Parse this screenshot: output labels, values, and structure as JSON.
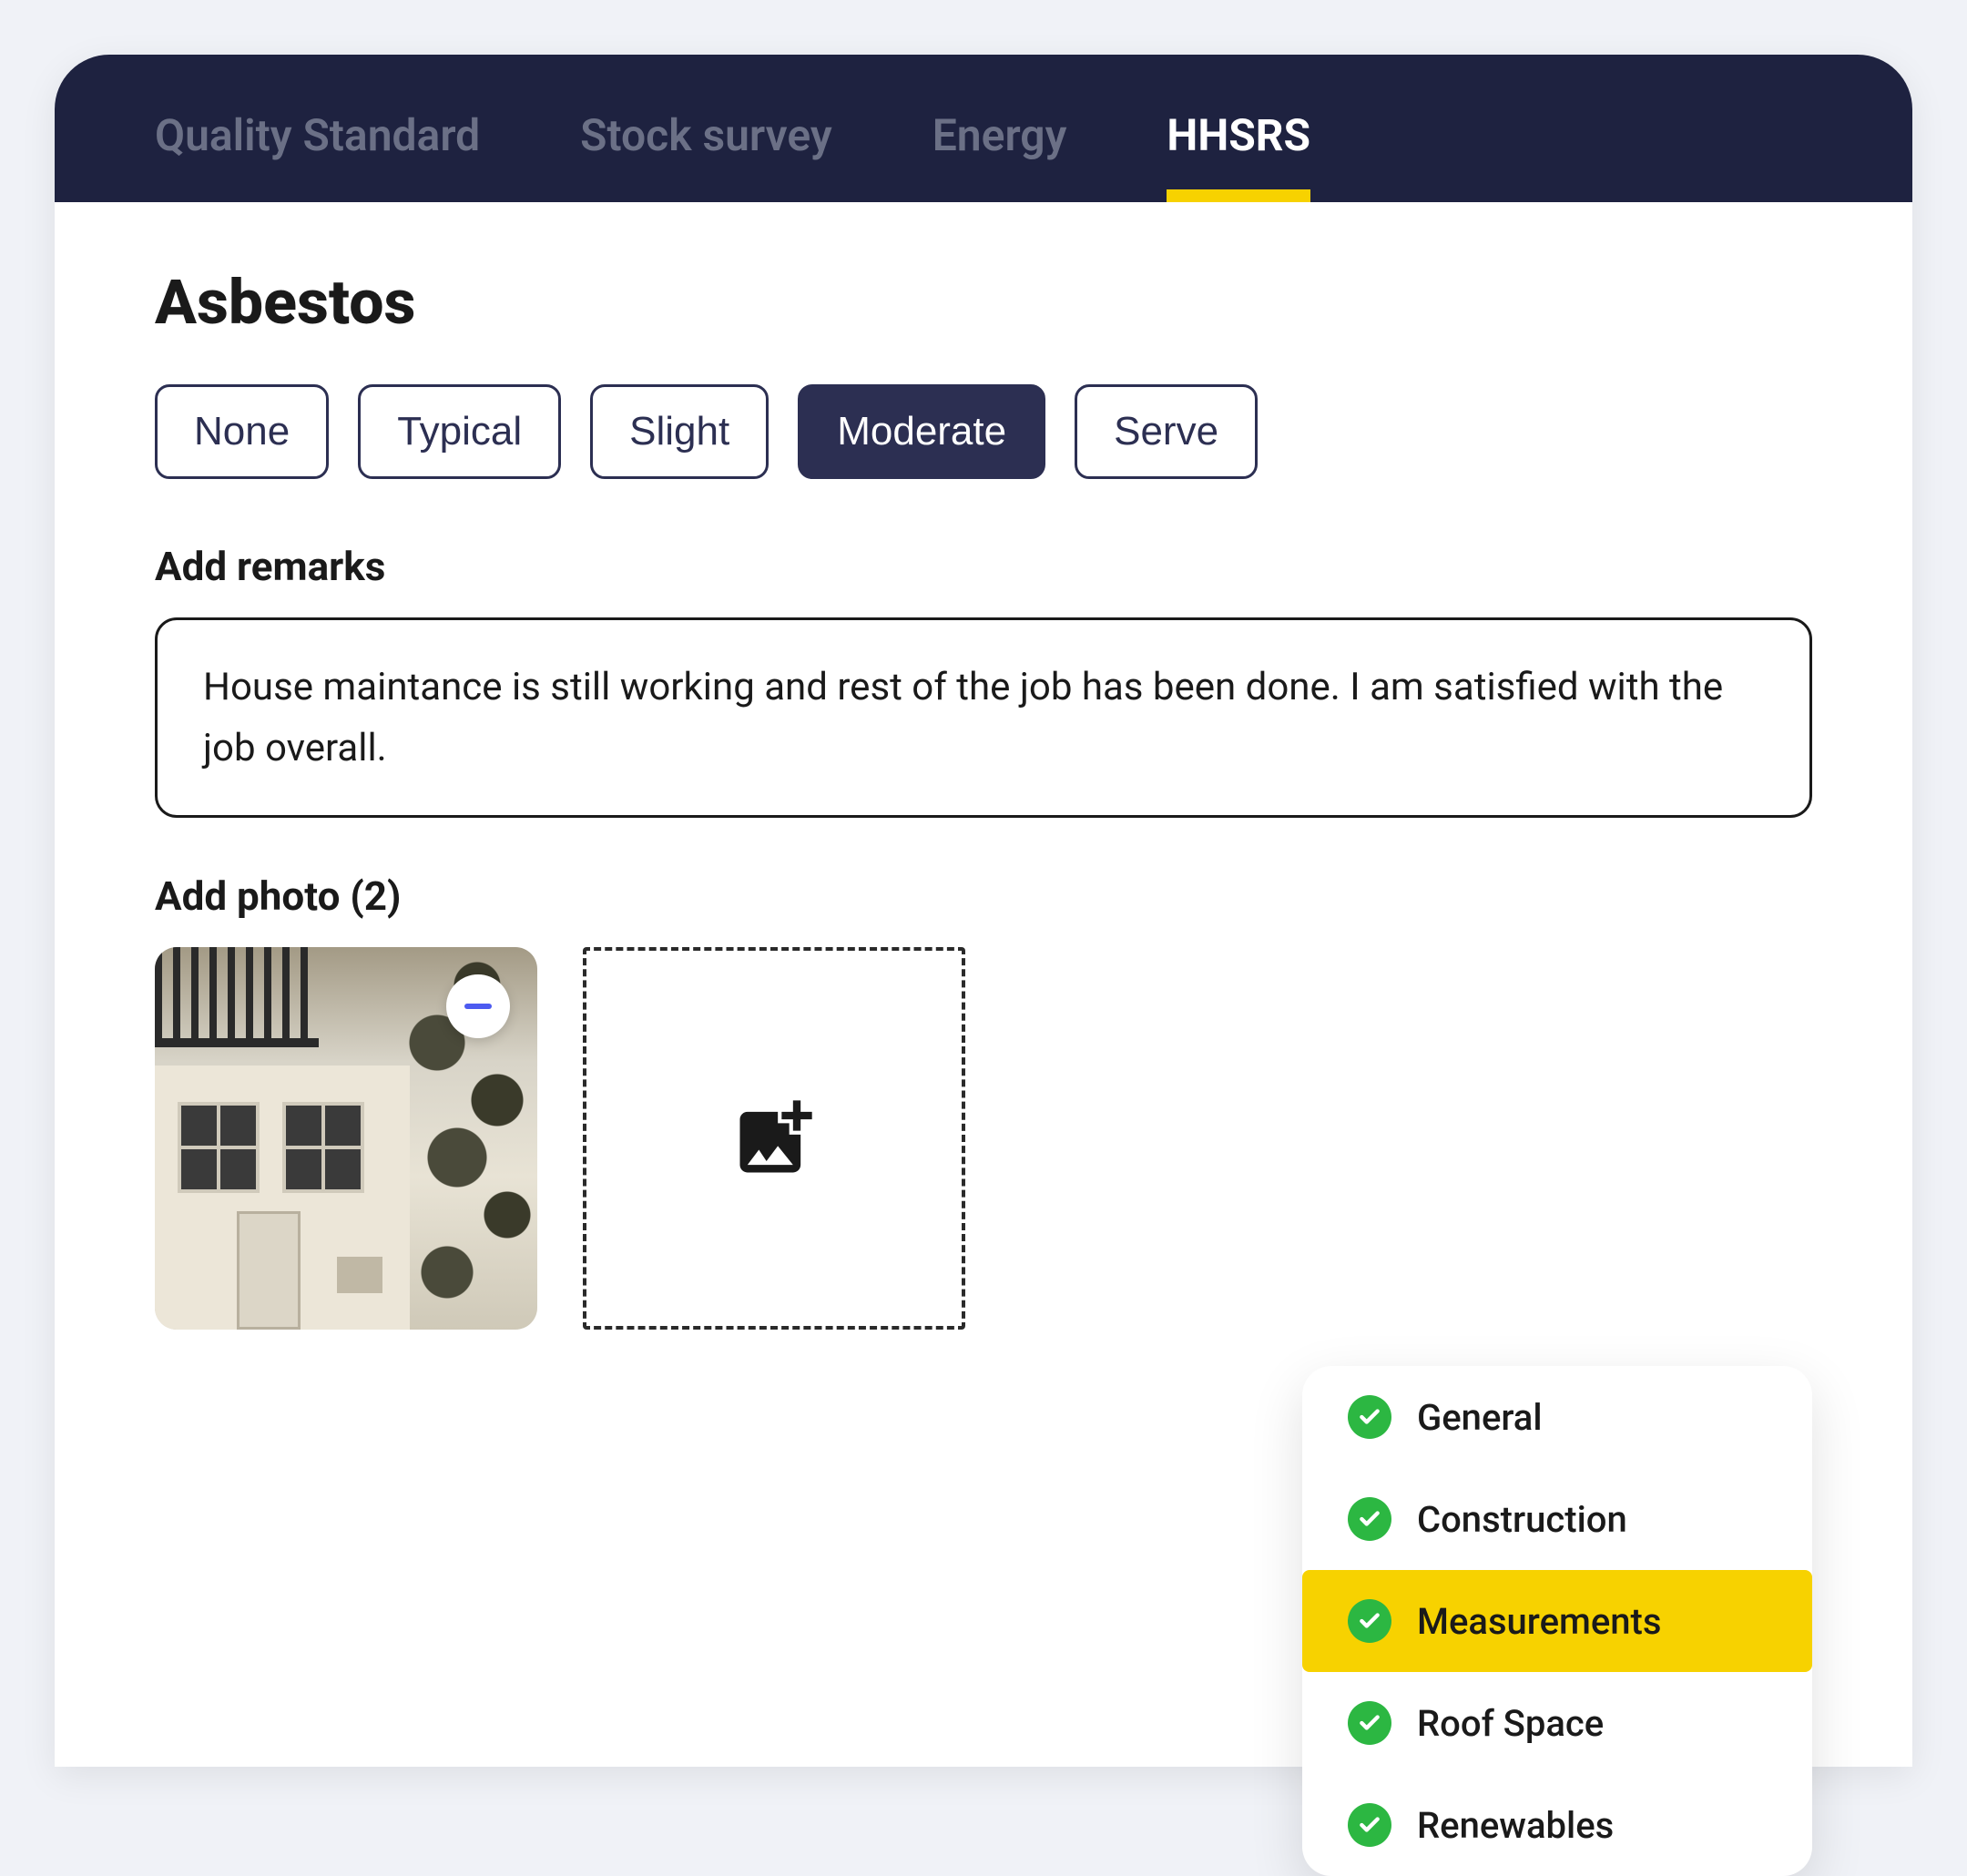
{
  "tabs": [
    {
      "label": "Quality Standard",
      "active": false
    },
    {
      "label": "Stock survey",
      "active": false
    },
    {
      "label": "Energy",
      "active": false
    },
    {
      "label": "HHSRS",
      "active": true
    }
  ],
  "page_title": "Asbestos",
  "severity": {
    "options": [
      "None",
      "Typical",
      "Slight",
      "Moderate",
      "Serve"
    ],
    "selected": "Moderate"
  },
  "remarks": {
    "label": "Add remarks",
    "value": "House maintance is still working and rest of the job has been done. I am satisfied with the job overall."
  },
  "photos": {
    "label": "Add photo (2)",
    "count": 2
  },
  "checklist": [
    {
      "label": "General",
      "done": true,
      "highlighted": false
    },
    {
      "label": "Construction",
      "done": true,
      "highlighted": false
    },
    {
      "label": "Measurements",
      "done": true,
      "highlighted": true
    },
    {
      "label": "Roof Space",
      "done": true,
      "highlighted": false
    },
    {
      "label": "Renewables",
      "done": true,
      "highlighted": false
    }
  ],
  "colors": {
    "header_bg": "#1e2240",
    "accent_yellow": "#f7d200",
    "success_green": "#2cb742",
    "primary_dark": "#2c2f52"
  }
}
